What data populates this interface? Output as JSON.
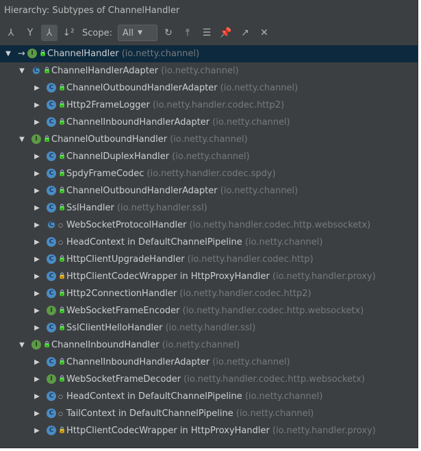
{
  "window": {
    "title": "Hierarchy:  Subtypes of ChannelHandler"
  },
  "toolbar": {
    "scope_label": "Scope:",
    "scope_value": "All"
  },
  "colors": {
    "background": "#3c3f41",
    "selected_row": "#0d293e",
    "class_icon": "#4a8cc4",
    "interface_icon": "#5d9a48",
    "package_text": "#787a7c"
  },
  "tree": {
    "rows": [
      {
        "depth": 0,
        "expanded": true,
        "kind": "interface",
        "vis": "public",
        "name": "ChannelHandler",
        "pkg": "(io.netty.channel)",
        "selected": true
      },
      {
        "depth": 1,
        "expanded": true,
        "kind": "abstract",
        "vis": "public",
        "name": "ChannelHandlerAdapter",
        "pkg": "(io.netty.channel)"
      },
      {
        "depth": 2,
        "expanded": false,
        "kind": "class",
        "vis": "public",
        "name": "ChannelOutboundHandlerAdapter",
        "pkg": "(io.netty.channel)"
      },
      {
        "depth": 2,
        "expanded": false,
        "kind": "class",
        "vis": "public",
        "name": "Http2FrameLogger",
        "pkg": "(io.netty.handler.codec.http2)"
      },
      {
        "depth": 2,
        "expanded": false,
        "kind": "class",
        "vis": "public",
        "name": "ChannelInboundHandlerAdapter",
        "pkg": "(io.netty.channel)"
      },
      {
        "depth": 1,
        "expanded": true,
        "kind": "interface",
        "vis": "public",
        "name": "ChannelOutboundHandler",
        "pkg": "(io.netty.channel)"
      },
      {
        "depth": 2,
        "expanded": false,
        "kind": "class",
        "vis": "public",
        "name": "ChannelDuplexHandler",
        "pkg": "(io.netty.channel)"
      },
      {
        "depth": 2,
        "expanded": false,
        "kind": "class",
        "vis": "public",
        "name": "SpdyFrameCodec",
        "pkg": "(io.netty.handler.codec.spdy)"
      },
      {
        "depth": 2,
        "expanded": false,
        "kind": "class",
        "vis": "public",
        "name": "ChannelOutboundHandlerAdapter",
        "pkg": "(io.netty.channel)"
      },
      {
        "depth": 2,
        "expanded": false,
        "kind": "class",
        "vis": "public",
        "name": "SslHandler",
        "pkg": "(io.netty.handler.ssl)"
      },
      {
        "depth": 2,
        "expanded": false,
        "kind": "abstract",
        "vis": "package",
        "name": "WebSocketProtocolHandler",
        "pkg": "(io.netty.handler.codec.http.websocketx)"
      },
      {
        "depth": 2,
        "expanded": false,
        "kind": "class",
        "vis": "package",
        "name": "HeadContext in DefaultChannelPipeline",
        "pkg": "(io.netty.channel)"
      },
      {
        "depth": 2,
        "expanded": false,
        "kind": "class",
        "vis": "public",
        "name": "HttpClientUpgradeHandler",
        "pkg": "(io.netty.handler.codec.http)"
      },
      {
        "depth": 2,
        "expanded": false,
        "kind": "class",
        "vis": "private",
        "name": "HttpClientCodecWrapper in HttpProxyHandler",
        "pkg": "(io.netty.handler.proxy)"
      },
      {
        "depth": 2,
        "expanded": false,
        "kind": "class",
        "vis": "public",
        "name": "Http2ConnectionHandler",
        "pkg": "(io.netty.handler.codec.http2)"
      },
      {
        "depth": 2,
        "expanded": false,
        "kind": "interface",
        "vis": "public",
        "name": "WebSocketFrameEncoder",
        "pkg": "(io.netty.handler.codec.http.websocketx)"
      },
      {
        "depth": 2,
        "expanded": false,
        "kind": "class",
        "vis": "public",
        "name": "SslClientHelloHandler",
        "pkg": "(io.netty.handler.ssl)"
      },
      {
        "depth": 1,
        "expanded": true,
        "kind": "interface",
        "vis": "public",
        "name": "ChannelInboundHandler",
        "pkg": "(io.netty.channel)"
      },
      {
        "depth": 2,
        "expanded": false,
        "kind": "class",
        "vis": "public",
        "name": "ChannelInboundHandlerAdapter",
        "pkg": "(io.netty.channel)"
      },
      {
        "depth": 2,
        "expanded": false,
        "kind": "interface",
        "vis": "public",
        "name": "WebSocketFrameDecoder",
        "pkg": "(io.netty.handler.codec.http.websocketx)"
      },
      {
        "depth": 2,
        "expanded": false,
        "kind": "class",
        "vis": "package",
        "name": "HeadContext in DefaultChannelPipeline",
        "pkg": "(io.netty.channel)"
      },
      {
        "depth": 2,
        "expanded": false,
        "kind": "class",
        "vis": "package",
        "name": "TailContext in DefaultChannelPipeline",
        "pkg": "(io.netty.channel)"
      },
      {
        "depth": 2,
        "expanded": false,
        "kind": "class",
        "vis": "private",
        "name": "HttpClientCodecWrapper in HttpProxyHandler",
        "pkg": "(io.netty.handler.proxy)"
      }
    ]
  }
}
